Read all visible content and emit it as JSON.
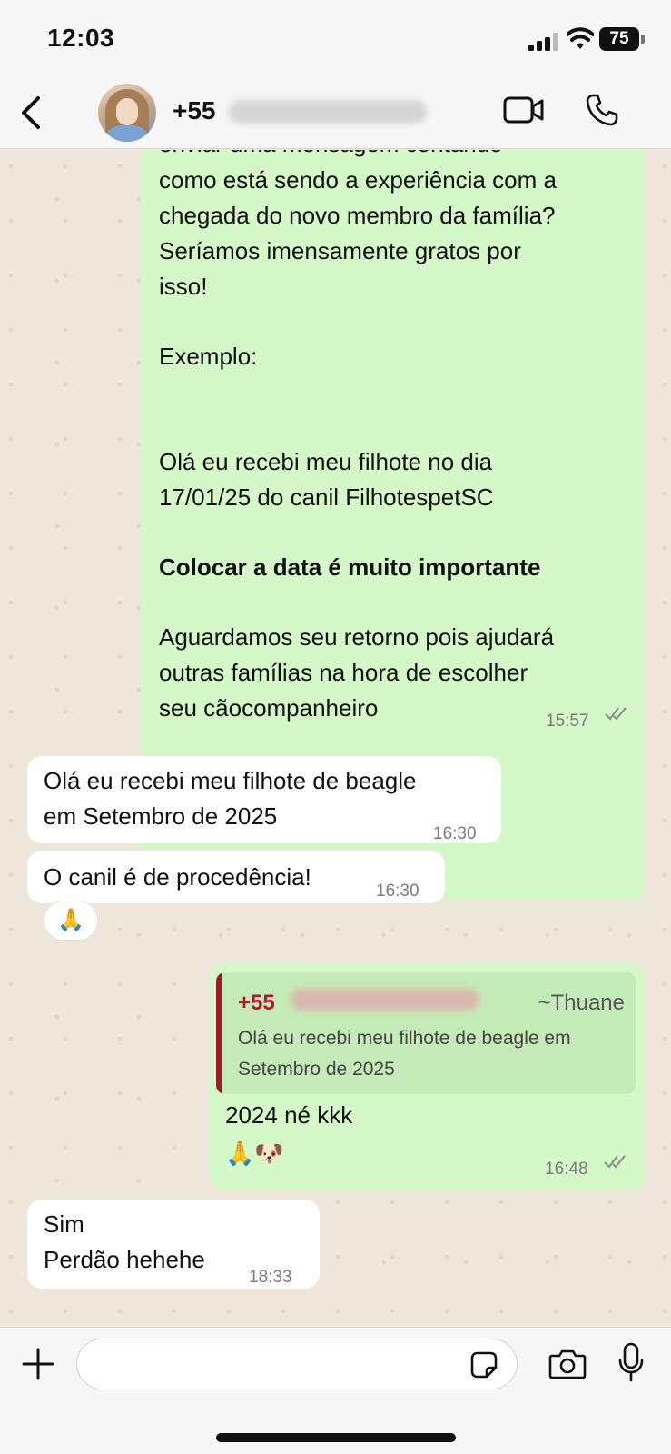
{
  "status_bar": {
    "time": "12:03",
    "battery": "75"
  },
  "header": {
    "contact_prefix": "+55"
  },
  "messages": [
    {
      "type": "outgoing",
      "lines": [
        "enviar uma mensagem contando",
        "como está sendo a experiência com a",
        "chegada do novo membro da família?",
        "Seríamos imensamente gratos por",
        "isso!",
        "Exemplo:",
        "Olá eu recebi meu filhote no dia",
        "17/01/25 do canil FilhotespetSC",
        "Colocar a data é muito importante",
        "Aguardamos seu retorno pois ajudará",
        "outras famílias na hora de escolher",
        "seu cãocompanheiro"
      ],
      "time": "15:57"
    },
    {
      "type": "incoming",
      "lines": [
        "Olá eu recebi meu filhote de beagle",
        "em Setembro de 2025"
      ],
      "time": "16:30"
    },
    {
      "type": "incoming",
      "lines": [
        "O canil é de procedência!"
      ],
      "time": "16:30",
      "reaction": "🙏"
    },
    {
      "type": "outgoing",
      "reply": {
        "sender": "+55",
        "alias": "~Thuane",
        "lines": [
          "Olá eu recebi meu filhote de beagle em",
          "Setembro de 2025"
        ]
      },
      "lines": [
        "2024 né kkk",
        "🙏🐶"
      ],
      "time": "16:48"
    },
    {
      "type": "incoming",
      "lines": [
        "Sim",
        "Perdão hehehe"
      ],
      "time": "18:33"
    }
  ],
  "input": {
    "placeholder": ""
  },
  "icons": {
    "back": "chevron-left-icon",
    "video": "video-call-icon",
    "phone": "phone-icon",
    "plus": "plus-icon",
    "sticker": "sticker-icon",
    "camera": "camera-icon",
    "mic": "microphone-icon",
    "read_receipt": "double-check-icon"
  },
  "colors": {
    "outgoing_bubble": "#d4f8c8",
    "incoming_bubble": "#ffffff",
    "reply_accent": "#a3162c",
    "chat_background": "#efe7dc"
  }
}
